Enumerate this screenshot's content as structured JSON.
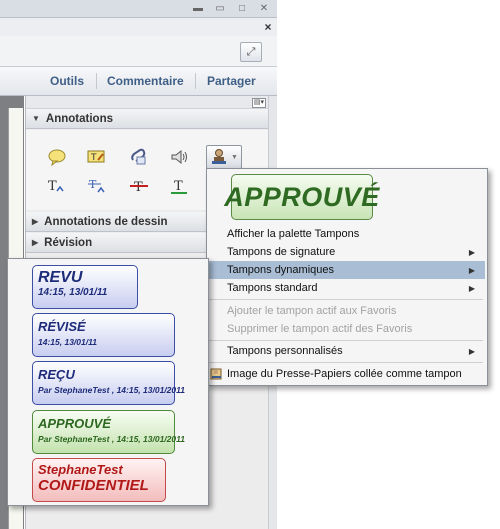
{
  "window": {
    "close_glyph": "×",
    "fullscreen_glyph": "⤢"
  },
  "tabs": [
    "Outils",
    "Commentaire",
    "Partager"
  ],
  "sections": {
    "annotations": "Annotations",
    "drawing": "Annotations de dessin",
    "revision": "Révision"
  },
  "annotation_tools": [
    "note-icon",
    "text-note-icon",
    "attach-file-icon",
    "sound-icon",
    "stamp-icon",
    "insert-text-icon",
    "replace-text-icon",
    "strikethrough-icon",
    "underline-icon"
  ],
  "menu": {
    "preview_stamp": "APPROUVÉ",
    "items": [
      {
        "label": "Afficher la palette Tampons",
        "submenu": false,
        "disabled": false,
        "selected": false
      },
      {
        "label": "Tampons de signature",
        "submenu": true,
        "disabled": false,
        "selected": false
      },
      {
        "label": "Tampons dynamiques",
        "submenu": true,
        "disabled": false,
        "selected": true
      },
      {
        "label": "Tampons standard",
        "submenu": true,
        "disabled": false,
        "selected": false
      },
      {
        "label": "Ajouter le tampon actif aux Favoris",
        "submenu": false,
        "disabled": true,
        "selected": false
      },
      {
        "label": "Supprimer le tampon actif des Favoris",
        "submenu": false,
        "disabled": true,
        "selected": false
      },
      {
        "label": "Tampons personnalisés",
        "submenu": true,
        "disabled": false,
        "selected": false
      },
      {
        "label": "Image du Presse-Papiers collée comme tampon",
        "submenu": false,
        "disabled": false,
        "selected": false
      }
    ]
  },
  "dynamic_stamps": [
    {
      "line1": "REVU",
      "line2": "14:15, 13/01/11",
      "color": "blue"
    },
    {
      "line1": "RÉVISÉ",
      "line2": "14:15, 13/01/11",
      "color": "blue"
    },
    {
      "line1": "REÇU",
      "line2": "Par StephaneTest , 14:15, 13/01/2011",
      "color": "blue"
    },
    {
      "line1": "APPROUVÉ",
      "line2": "Par StephaneTest , 14:15, 13/01/2011",
      "color": "green"
    },
    {
      "line1": "StephaneTest",
      "line2": "CONFIDENTIEL",
      "color": "red"
    }
  ]
}
